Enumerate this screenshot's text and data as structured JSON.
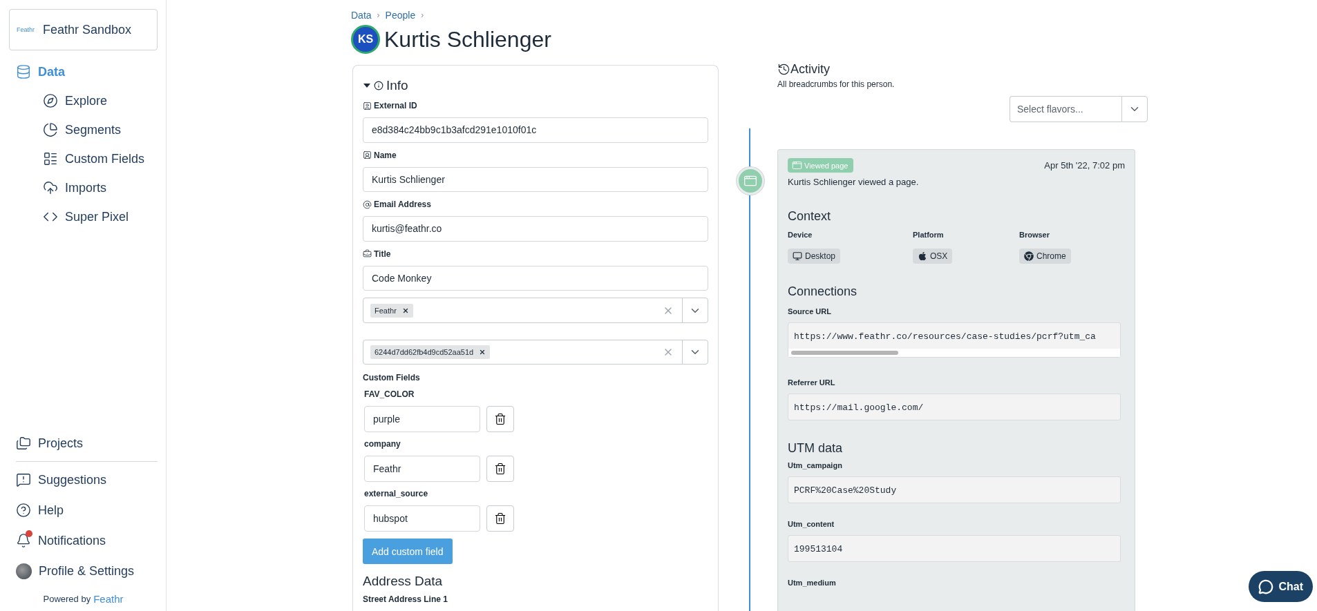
{
  "sidebar": {
    "workspace": {
      "logo": "Feathr",
      "name": "Feathr Sandbox"
    },
    "nav": [
      {
        "label": "Data",
        "selected": true,
        "children": [
          {
            "label": "Explore",
            "selected": false
          },
          {
            "label": "Segments",
            "selected": false
          },
          {
            "label": "Custom Fields",
            "selected": false
          },
          {
            "label": "Imports",
            "selected": false
          },
          {
            "label": "Super Pixel",
            "selected": false
          }
        ]
      }
    ],
    "footer": [
      {
        "label": "Projects",
        "kind": "projects"
      },
      {
        "label": "Suggestions",
        "kind": "suggestions"
      },
      {
        "label": "Help",
        "kind": "help"
      },
      {
        "label": "Notifications",
        "kind": "notifications",
        "alert": true
      },
      {
        "label": "Profile & Settings",
        "kind": "profile"
      }
    ],
    "powered_by": {
      "text": "Powered by",
      "brand": "Feathr"
    }
  },
  "breadcrumbs": {
    "separator": "›",
    "items": [
      "Data",
      "People"
    ]
  },
  "person": {
    "initials": "KS",
    "name": "Kurtis Schlienger"
  },
  "info": {
    "title": "Info",
    "expanded": true,
    "fields": [
      {
        "kind": "id",
        "label": "External ID",
        "value": "e8d384c24bb9c1b3afcd291e1010f01c"
      },
      {
        "kind": "name",
        "label": "Name",
        "value": "Kurtis Schlienger"
      },
      {
        "kind": "email",
        "label": "Email Address",
        "value": "kurtis@feathr.co"
      },
      {
        "kind": "title",
        "label": "Title",
        "value": "Code Monkey"
      }
    ],
    "selects": [
      {
        "tags": [
          "Feathr"
        ]
      },
      {
        "tags": [
          "6244d7dd62fb4d9cd52aa51d"
        ]
      }
    ],
    "custom_fields": {
      "title": "Custom Fields",
      "items": [
        {
          "name": "FAV_COLOR",
          "value": "purple"
        },
        {
          "name": "company",
          "value": "Feathr"
        },
        {
          "name": "external_source",
          "value": "hubspot"
        }
      ],
      "add_button": "Add custom field"
    },
    "address": {
      "title": "Address Data",
      "fields": [
        {
          "label": "Street Address Line 1"
        }
      ]
    }
  },
  "activity": {
    "title": "Activity",
    "subtitle": "All breadcrumbs for this person.",
    "filter": {
      "placeholder": "Select flavors..."
    },
    "events": [
      {
        "badge": "Viewed page",
        "time": "Apr 5th '22, 7:02 pm",
        "description": "Kurtis Schlienger viewed a page.",
        "context": {
          "title": "Context",
          "items": [
            {
              "kind": "device",
              "label": "Device",
              "value": "Desktop"
            },
            {
              "kind": "platform",
              "label": "Platform",
              "value": "OSX"
            },
            {
              "kind": "browser",
              "label": "Browser",
              "value": "Chrome"
            }
          ]
        },
        "connections": {
          "title": "Connections",
          "items": [
            {
              "label": "Source URL",
              "value": "https://www.feathr.co/resources/case-studies/pcrf?utm_ca",
              "scroll": true
            },
            {
              "label": "Referrer URL",
              "value": "https://mail.google.com/",
              "scroll": false
            }
          ]
        },
        "utm": {
          "title": "UTM data",
          "items": [
            {
              "label": "Utm_campaign",
              "value": "PCRF%20Case%20Study"
            },
            {
              "label": "Utm_content",
              "value": "199513104"
            },
            {
              "label": "Utm_medium"
            }
          ]
        }
      }
    ]
  },
  "chat": {
    "label": "Chat"
  }
}
